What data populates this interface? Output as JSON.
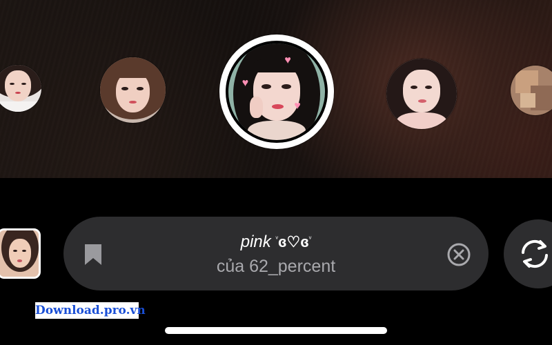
{
  "filter": {
    "name": "pink",
    "decoration_prefix": "ᵥ",
    "decoration": "ɞ♡ɞ",
    "decoration_suffix": "ᵥ",
    "author": "của 62_percent"
  },
  "watermark": {
    "text": "Download.pro.vn"
  },
  "icons": {
    "bookmark": "bookmark-icon",
    "clear": "close-circle-icon",
    "flip_camera": "camera-switch-icon"
  },
  "colors": {
    "pill_background": "#2d2d2f",
    "author_text": "#a9a9ad",
    "watermark_text": "#1a4fd6",
    "heart": "#ff8fb4"
  }
}
